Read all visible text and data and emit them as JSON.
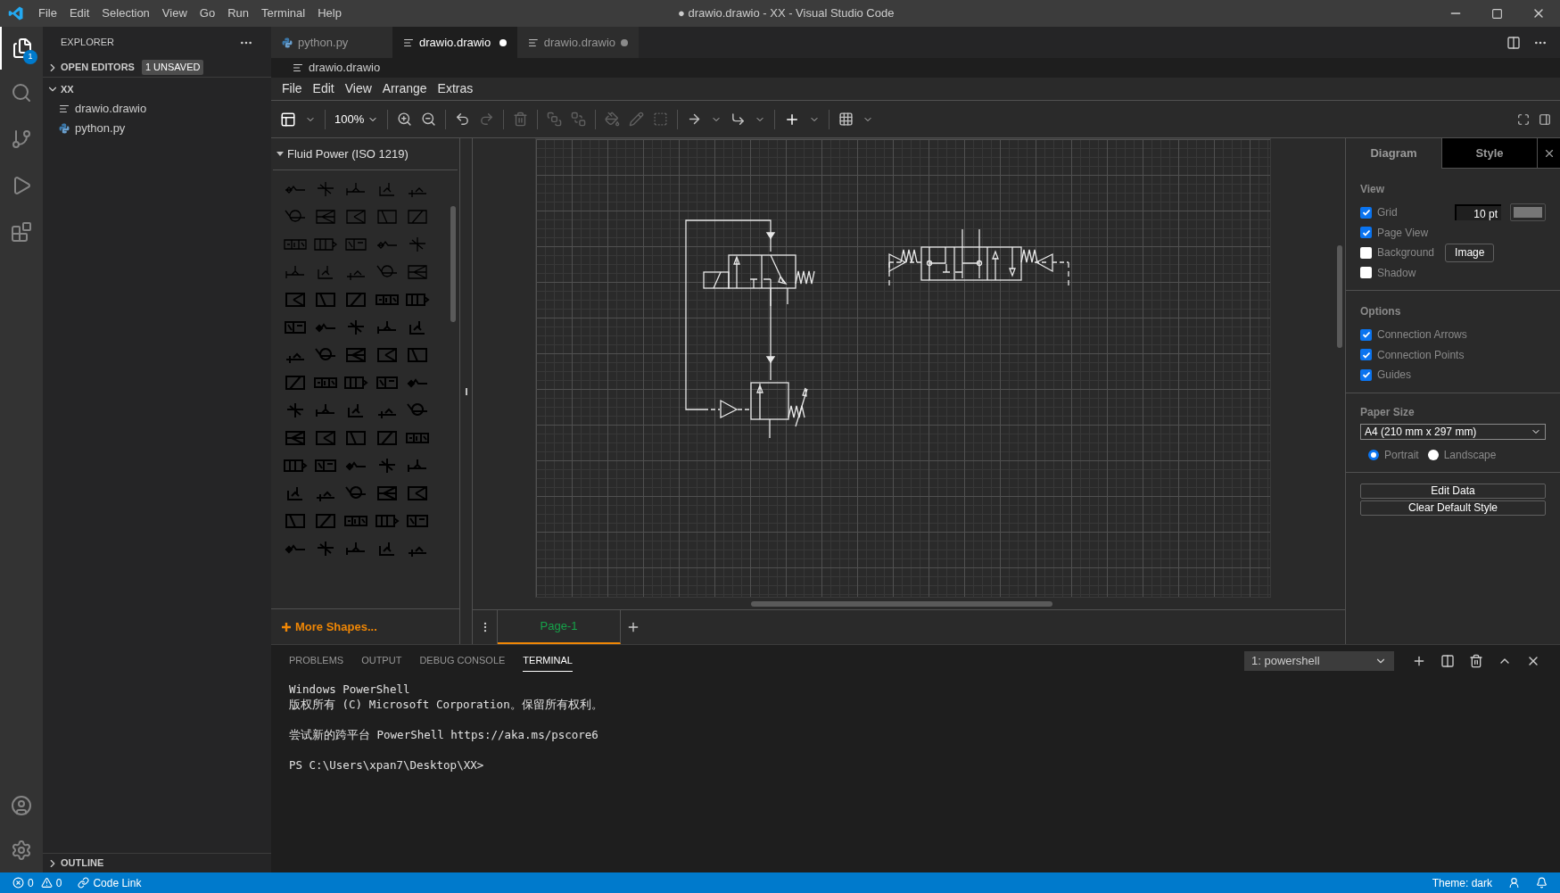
{
  "title_bar": {
    "menu": [
      "File",
      "Edit",
      "Selection",
      "View",
      "Go",
      "Run",
      "Terminal",
      "Help"
    ],
    "title": "● drawio.drawio - XX - Visual Studio Code"
  },
  "activity_bar": {
    "badge": "1"
  },
  "explorer": {
    "title": "EXPLORER",
    "open_editors": {
      "label": "OPEN EDITORS",
      "badge": "1 UNSAVED",
      "expanded": false
    },
    "folder": {
      "label": "XX",
      "expanded": true,
      "files": [
        {
          "name": "drawio.drawio",
          "kind": "text"
        },
        {
          "name": "python.py",
          "kind": "python"
        }
      ]
    },
    "outline": {
      "label": "OUTLINE",
      "expanded": false
    }
  },
  "editor_tabs": [
    {
      "label": "python.py",
      "kind": "python",
      "selected": false,
      "modified": false
    },
    {
      "label": "drawio.drawio",
      "kind": "text",
      "selected": true,
      "modified": true
    },
    {
      "label": "drawio.drawio",
      "kind": "text",
      "selected": false,
      "modified": true
    }
  ],
  "breadcrumb": "drawio.drawio",
  "drawio": {
    "menu": [
      "File",
      "Edit",
      "View",
      "Arrange",
      "Extras"
    ],
    "zoom": "100%",
    "shapes": {
      "section": "Fluid Power (ISO 1219)",
      "expanded": true,
      "more": "More Shapes..."
    },
    "page_tabs": [
      {
        "label": "Page-1",
        "selected": true
      }
    ]
  },
  "format_panel": {
    "tabs": [
      {
        "label": "Diagram",
        "selected": true
      },
      {
        "label": "Style",
        "selected": false
      }
    ],
    "view": {
      "title": "View",
      "items": [
        {
          "label": "Grid",
          "checked": true,
          "value": "10 pt"
        },
        {
          "label": "Page View",
          "checked": true
        },
        {
          "label": "Background",
          "checked": false,
          "button": "Image"
        },
        {
          "label": "Shadow",
          "checked": false
        }
      ]
    },
    "options": {
      "title": "Options",
      "items": [
        {
          "label": "Connection Arrows",
          "checked": true
        },
        {
          "label": "Connection Points",
          "checked": true
        },
        {
          "label": "Guides",
          "checked": true
        }
      ]
    },
    "paper": {
      "title": "Paper Size",
      "value": "A4 (210 mm x 297 mm)",
      "orientation": [
        {
          "label": "Portrait",
          "selected": true
        },
        {
          "label": "Landscape",
          "selected": false
        }
      ]
    },
    "buttons": [
      "Edit Data",
      "Clear Default Style"
    ]
  },
  "panel": {
    "tabs": [
      {
        "label": "PROBLEMS",
        "selected": false
      },
      {
        "label": "OUTPUT",
        "selected": false
      },
      {
        "label": "DEBUG CONSOLE",
        "selected": false
      },
      {
        "label": "TERMINAL",
        "selected": true
      }
    ],
    "terminal_select": "1: powershell",
    "terminal_blocks": [
      [
        "Windows PowerShell",
        "版权所有 (C) Microsoft Corporation。保留所有权利。"
      ],
      [
        "尝试新的跨平台 PowerShell https://aka.ms/pscore6"
      ],
      [
        "PS C:\\Users\\xpan7\\Desktop\\XX>"
      ]
    ]
  },
  "status_bar": {
    "errors": "0",
    "warnings": "0",
    "link": "Code Link",
    "theme": "Theme: dark"
  }
}
